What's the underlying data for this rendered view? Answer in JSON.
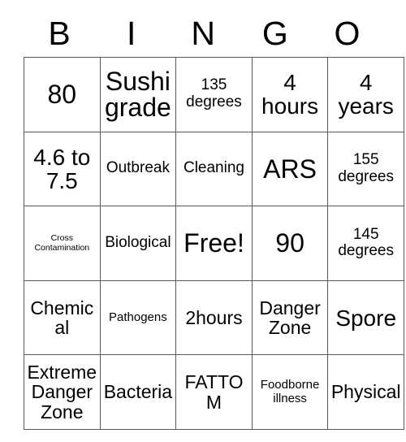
{
  "card": {
    "title_letters": [
      "B",
      "I",
      "N",
      "G",
      "O"
    ],
    "grid": {
      "rows": 5,
      "columns": 5,
      "cells": [
        [
          {
            "text": "80",
            "size": "fs-xl"
          },
          {
            "text": "Sushi grade",
            "size": "fs-xl"
          },
          {
            "text": "135 degrees",
            "size": "fs-sm"
          },
          {
            "text": "4 hours",
            "size": "fs-lg"
          },
          {
            "text": "4 years",
            "size": "fs-lg"
          }
        ],
        [
          {
            "text": "4.6 to 7.5",
            "size": "fs-lg"
          },
          {
            "text": "Outbreak",
            "size": "fs-sm"
          },
          {
            "text": "Cleaning",
            "size": "fs-sm"
          },
          {
            "text": "ARS",
            "size": "fs-xl"
          },
          {
            "text": "155 degrees",
            "size": "fs-sm"
          }
        ],
        [
          {
            "text": "Cross Contamination",
            "size": "fs-xxs"
          },
          {
            "text": "Biological",
            "size": "fs-sm"
          },
          {
            "text": "Free!",
            "size": "fs-xl"
          },
          {
            "text": "90",
            "size": "fs-xl"
          },
          {
            "text": "145 degrees",
            "size": "fs-sm"
          }
        ],
        [
          {
            "text": "Chemical",
            "size": "fs-md"
          },
          {
            "text": "Pathogens",
            "size": "fs-xs"
          },
          {
            "text": "2hours",
            "size": "fs-md"
          },
          {
            "text": "Danger Zone",
            "size": "fs-md"
          },
          {
            "text": "Spore",
            "size": "fs-lg"
          }
        ],
        [
          {
            "text": "Extreme Danger Zone",
            "size": "fs-md"
          },
          {
            "text": "Bacteria",
            "size": "fs-md"
          },
          {
            "text": "FATTOM",
            "size": "fs-md"
          },
          {
            "text": "Foodborne illness",
            "size": "fs-xs"
          },
          {
            "text": "Physical",
            "size": "fs-md"
          }
        ]
      ]
    },
    "colors": {
      "background": "#ffffff",
      "text": "#000000",
      "grid_line": "#595959"
    }
  }
}
